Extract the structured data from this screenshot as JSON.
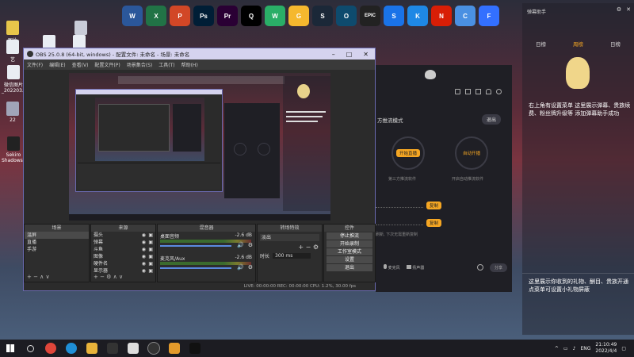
{
  "desktop": {
    "icons": [
      {
        "label": "图片"
      },
      {
        "label": "艺"
      },
      {
        "label": "微信图片_202203..."
      },
      {
        "label": "22"
      },
      {
        "label": "Sekiro Shadows..."
      }
    ]
  },
  "dock": {
    "apps": [
      {
        "name": "word-icon",
        "glyph": "W",
        "color": "#2b579a"
      },
      {
        "name": "excel-icon",
        "glyph": "X",
        "color": "#217346"
      },
      {
        "name": "powerpoint-icon",
        "glyph": "P",
        "color": "#d24726"
      },
      {
        "name": "photoshop-icon",
        "glyph": "Ps",
        "color": "#001e36"
      },
      {
        "name": "premiere-icon",
        "glyph": "Pr",
        "color": "#2a0034"
      },
      {
        "name": "qq-icon",
        "glyph": "Q",
        "color": "#000000"
      },
      {
        "name": "wechat-icon",
        "glyph": "W",
        "color": "#2aae67"
      },
      {
        "name": "game-icon",
        "glyph": "G",
        "color": "#f5b82e"
      },
      {
        "name": "steam-icon",
        "glyph": "S",
        "color": "#1b2838"
      },
      {
        "name": "app-icon",
        "glyph": "O",
        "color": "#0e4b6e"
      },
      {
        "name": "epic-games-icon",
        "glyph": "EPIC",
        "color": "#222222"
      },
      {
        "name": "screenshot-icon",
        "glyph": "S",
        "color": "#1a73e8"
      },
      {
        "name": "k-icon",
        "glyph": "K",
        "color": "#1e88e5"
      },
      {
        "name": "netease-music-icon",
        "glyph": "N",
        "color": "#d81e06"
      },
      {
        "name": "cloud-icon",
        "glyph": "C",
        "color": "#4a90e2"
      },
      {
        "name": "feishu-icon",
        "glyph": "F",
        "color": "#3370ff"
      }
    ]
  },
  "obs": {
    "title": "OBS 25.0.8 (64-bit, windows) - 配置文件: 未命名 - 场景: 未命名",
    "menu": [
      "文件(F)",
      "编辑(E)",
      "查看(V)",
      "配置文件(P)",
      "场景集合(S)",
      "工具(T)",
      "帮助(H)"
    ],
    "scenes": {
      "header": "场景",
      "items": [
        "温屏",
        "直播",
        "手游"
      ]
    },
    "sources": {
      "header": "来源",
      "items": [
        "摄头",
        "弹幕",
        "斗鱼",
        "图像",
        "硬件名",
        "显示器"
      ]
    },
    "mixer": {
      "header": "混音器",
      "channels": [
        {
          "name": "桌面音频",
          "db": "-2.6 dB"
        },
        {
          "name": "麦克风/Aux",
          "db": "-2.6 dB"
        }
      ]
    },
    "transitions": {
      "header": "转场特效",
      "selected": "淡出",
      "duration_label": "时长",
      "duration_value": "300 ms"
    },
    "controls": {
      "header": "控件",
      "buttons": [
        "停止推流",
        "开始录制",
        "工作室模式",
        "设置",
        "退出"
      ]
    },
    "status": "LIVE: 00:00:00  REC: 00:00:00  CPU: 1.2%, 30.00 fps"
  },
  "live_app": {
    "mode_label": "方推流模式",
    "exit_label": "退出",
    "left_circle_label": "开始直播",
    "right_circle_label": "自动开播",
    "left_desc": "第三方推流软件",
    "right_desc": "开启自动推流软件",
    "copy_button": "复制",
    "copy_button_2": "复制",
    "hint": "刷新, 下次无需重新复制",
    "bottom_items": [
      "麦克风",
      "扬声器"
    ],
    "share_button": "分享"
  },
  "chat": {
    "header": "弹幕助手",
    "tabs": [
      "日榜",
      "周榜",
      "日榜"
    ],
    "message_top": "右上角有设置菜单 这里展示弹幕、贵族续费、粉丝牌升级等 添加弹幕助手成功",
    "message_bottom": "这里展示你收到的礼物、酬目、贵族开通 点菜单可设置小礼物屏蔽"
  },
  "taskbar": {
    "lang": "ENG",
    "time": "21:10:49",
    "date": "2022/4/4"
  }
}
